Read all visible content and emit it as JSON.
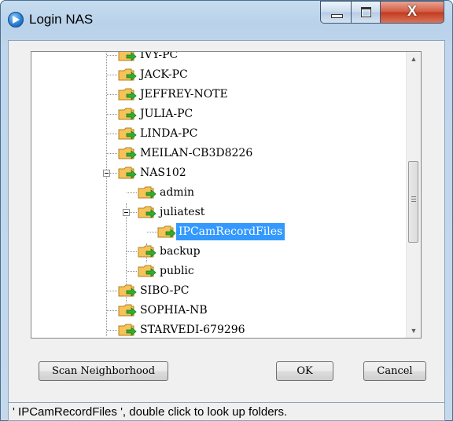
{
  "window": {
    "title": "Login NAS",
    "close_glyph": "X"
  },
  "tree": {
    "items": [
      {
        "label": "IVY-PC"
      },
      {
        "label": "JACK-PC"
      },
      {
        "label": "JEFFREY-NOTE"
      },
      {
        "label": "JULIA-PC"
      },
      {
        "label": "LINDA-PC"
      },
      {
        "label": "MEILAN-CB3D8226"
      },
      {
        "label": "NAS102"
      },
      {
        "label": "admin"
      },
      {
        "label": "juliatest"
      },
      {
        "label": "IPCamRecordFiles"
      },
      {
        "label": "backup"
      },
      {
        "label": "public"
      },
      {
        "label": "SIBO-PC"
      },
      {
        "label": "SOPHIA-NB"
      },
      {
        "label": "STARVEDI-679296"
      }
    ],
    "selected": "IPCamRecordFiles",
    "scroll_up_glyph": "▲",
    "scroll_down_glyph": "▼"
  },
  "buttons": {
    "scan": "Scan Neighborhood",
    "ok": "OK",
    "cancel": "Cancel"
  },
  "status": {
    "text": "' IPCamRecordFiles ', double click to look up folders."
  },
  "colors": {
    "selection": "#3399ff",
    "folder": "#f5c35a",
    "arrow": "#2fae2f"
  }
}
